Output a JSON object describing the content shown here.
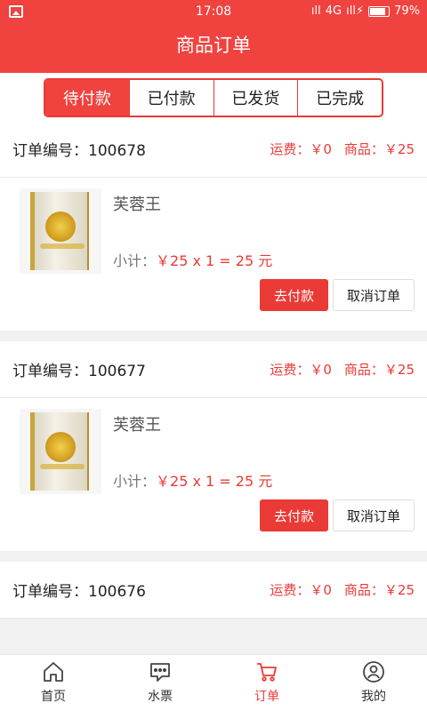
{
  "status": {
    "time": "17:08",
    "network": "4G",
    "battery": "79%"
  },
  "header": {
    "title": "商品订单"
  },
  "tabs": [
    {
      "label": "待付款",
      "active": true
    },
    {
      "label": "已付款",
      "active": false
    },
    {
      "label": "已发货",
      "active": false
    },
    {
      "label": "已完成",
      "active": false
    }
  ],
  "orders": [
    {
      "order_no": "订单编号：100678",
      "shipping": "运费：￥0",
      "goods": "商品：￥25",
      "product_name": "芙蓉王",
      "subtotal_label": "小计：",
      "subtotal_calc": "￥25 x 1 = 25 元",
      "pay_label": "去付款",
      "cancel_label": "取消订单"
    },
    {
      "order_no": "订单编号：100677",
      "shipping": "运费：￥0",
      "goods": "商品：￥25",
      "product_name": "芙蓉王",
      "subtotal_label": "小计：",
      "subtotal_calc": "￥25 x 1 = 25 元",
      "pay_label": "去付款",
      "cancel_label": "取消订单"
    },
    {
      "order_no": "订单编号：100676",
      "shipping": "运费：￥0",
      "goods": "商品：￥25"
    }
  ],
  "bottom_nav": [
    {
      "label": "首页",
      "icon": "home-icon"
    },
    {
      "label": "水票",
      "icon": "ticket-icon"
    },
    {
      "label": "订单",
      "icon": "cart-icon",
      "active": true
    },
    {
      "label": "我的",
      "icon": "profile-icon"
    }
  ],
  "colors": {
    "accent": "#f0423f",
    "price": "#e93a36"
  }
}
